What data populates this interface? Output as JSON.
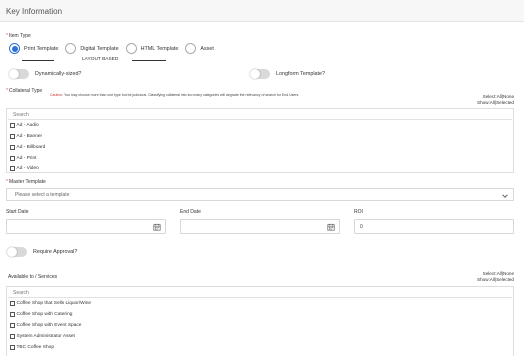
{
  "header": {
    "title": "Key Information"
  },
  "item_type": {
    "label": "Item Type",
    "options": [
      {
        "label": "Print Template",
        "selected": true
      },
      {
        "label": "Digital Template",
        "selected": false
      },
      {
        "label": "HTML Template",
        "selected": false
      },
      {
        "label": "Asset",
        "selected": false
      }
    ],
    "layout_note": "LAYOUT BASED"
  },
  "toggles": {
    "dynamically_sized": {
      "label": "Dynamically-sized?",
      "on": false
    },
    "longform": {
      "label": "Longform Template?",
      "on": false
    },
    "require_approval": {
      "label": "Require Approval?",
      "on": false
    }
  },
  "collateral_type": {
    "label": "Collateral Type",
    "caution_prefix": "Caution",
    "caution_text": ": You may choose more than one type but be judicious. Classifying collateral into too many categories will degrade the relevancy of search for End Users.",
    "select_label": "Select:",
    "select_all": "All",
    "select_sep": "|",
    "select_none": "None",
    "show_label": "Show:",
    "show_all": "All",
    "show_sep": "|",
    "show_selected": "Selected",
    "search_placeholder": "Search",
    "items": [
      "Ad - Audio",
      "Ad - Banner",
      "Ad - Billboard",
      "Ad - Print",
      "Ad - Video"
    ]
  },
  "master_template": {
    "label": "Master Template",
    "placeholder": "Please select a template"
  },
  "dates": {
    "start_label": "Start Date",
    "end_label": "End Date",
    "roi_label": "ROI",
    "roi_value": "0"
  },
  "services": {
    "label": "Available to / Services",
    "select_label": "Select:",
    "select_all": "All",
    "select_sep": "|",
    "select_none": "None",
    "show_label": "Show:",
    "show_all": "All",
    "show_sep": "|",
    "show_selected": "Selected",
    "search_placeholder": "Search",
    "items": [
      "Coffee Shop that Sells Liquor/Wine",
      "Coffee Shop with Catering",
      "Coffee Shop with Event Space",
      "System Administrator Asset",
      "TBC Coffee Shop"
    ]
  },
  "colors": {
    "accent": "#2f6fd6",
    "required": "#d9534f",
    "caution": "#c0392b"
  }
}
